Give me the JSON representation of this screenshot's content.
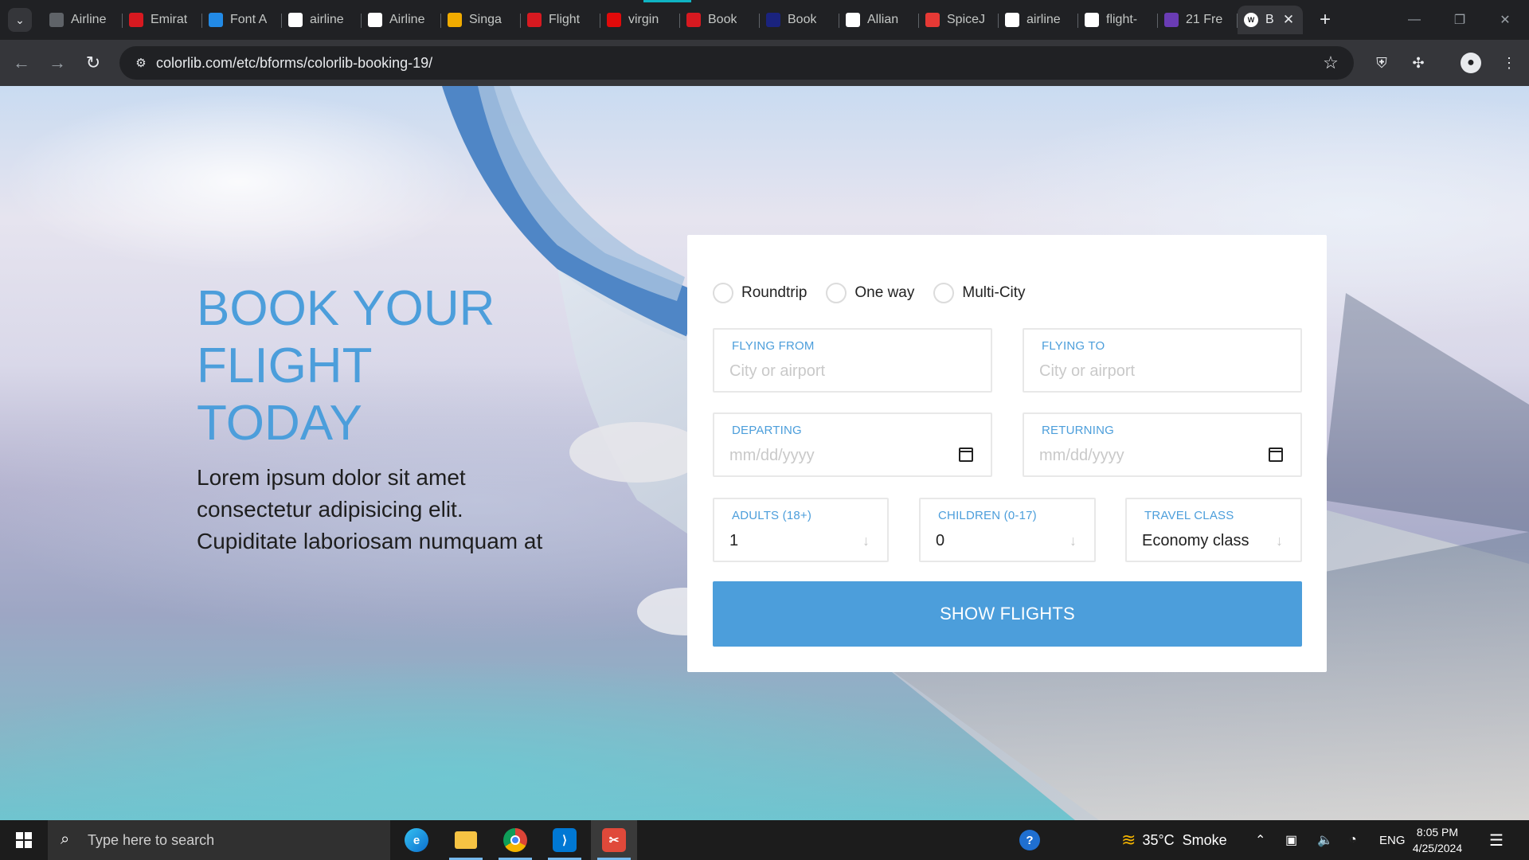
{
  "browser": {
    "tabs": [
      {
        "label": "Airline",
        "icon": "globe-icon",
        "color": "#5f6368"
      },
      {
        "label": "Emirat",
        "icon": "emirates-icon",
        "color": "#d71920"
      },
      {
        "label": "Font A",
        "icon": "flag-icon",
        "color": "#228ae6"
      },
      {
        "label": "airline",
        "icon": "google-icon",
        "color": "#ffffff"
      },
      {
        "label": "Airline",
        "icon": "airline-icon",
        "color": "#ffffff"
      },
      {
        "label": "Singa",
        "icon": "singapore-icon",
        "color": "#f0ab00"
      },
      {
        "label": "Flight",
        "icon": "flight-icon",
        "color": "#d71920"
      },
      {
        "label": "virgin",
        "icon": "virgin-icon",
        "color": "#e10a0a"
      },
      {
        "label": "Book",
        "icon": "book-icon",
        "color": "#d71920"
      },
      {
        "label": "Book",
        "icon": "plane-icon",
        "color": "#1a237e"
      },
      {
        "label": "Allian",
        "icon": "alliance-icon",
        "color": "#ffffff"
      },
      {
        "label": "SpiceJ",
        "icon": "spicejet-icon",
        "color": "#e53935"
      },
      {
        "label": "airline",
        "icon": "google-icon",
        "color": "#ffffff"
      },
      {
        "label": "flight-",
        "icon": "github-icon",
        "color": "#ffffff"
      },
      {
        "label": "21 Fre",
        "icon": "colorlib-icon",
        "color": "#6a3cb4"
      }
    ],
    "active_tab": {
      "label": "B",
      "icon": "wordpress-icon",
      "close": "✕"
    },
    "new_tab": "+",
    "url": "colorlib.com/etc/bforms/colorlib-booking-19/"
  },
  "page": {
    "hero_title": "BOOK YOUR FLIGHT TODAY",
    "hero_text": "Lorem ipsum dolor sit amet consectetur adipisicing elit. Cupiditate laboriosam numquam at",
    "trip_types": [
      "Roundtrip",
      "One way",
      "Multi-City"
    ],
    "flying_from": {
      "label": "FLYING FROM",
      "placeholder": "City or airport"
    },
    "flying_to": {
      "label": "FLYING TO",
      "placeholder": "City or airport"
    },
    "departing": {
      "label": "DEPARTING",
      "placeholder": "mm/dd/yyyy"
    },
    "returning": {
      "label": "RETURNING",
      "placeholder": "mm/dd/yyyy"
    },
    "adults": {
      "label": "ADULTS (18+)",
      "value": "1"
    },
    "children": {
      "label": "CHILDREN (0-17)",
      "value": "0"
    },
    "travel_class": {
      "label": "TRAVEL CLASS",
      "value": "Economy class"
    },
    "submit": "SHOW FLIGHTS",
    "accent_color": "#4c9edb"
  },
  "taskbar": {
    "search_placeholder": "Type here to search",
    "weather": "35°C  Smoke",
    "language": "ENG",
    "time": "8:05 PM",
    "date": "4/25/2024"
  }
}
